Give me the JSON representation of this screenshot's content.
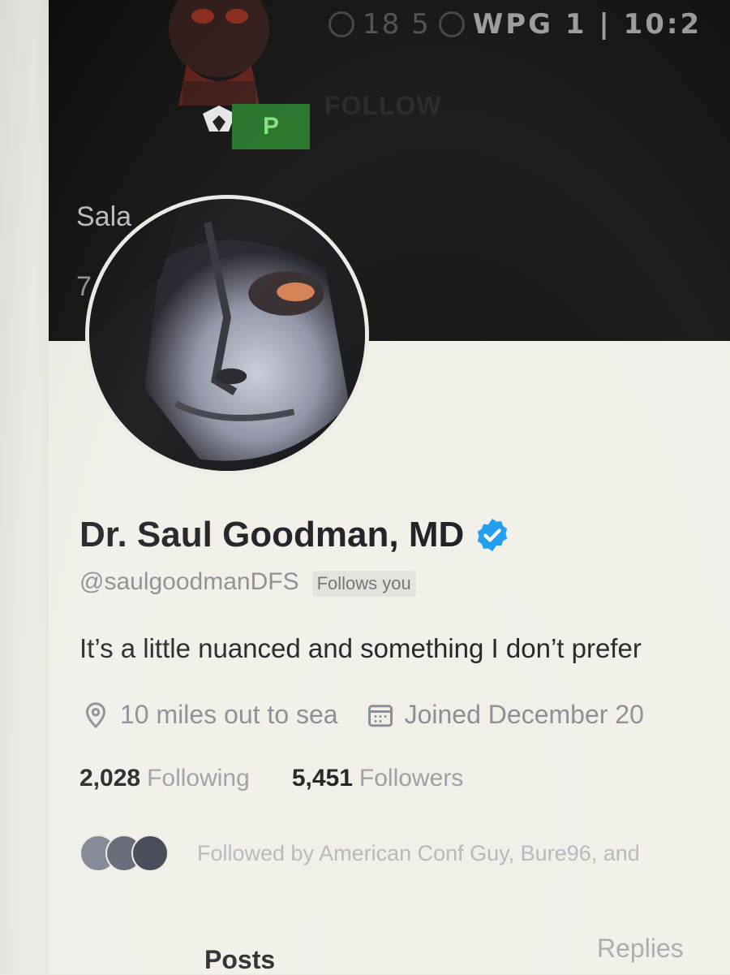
{
  "banner": {
    "stats_text": "18  5",
    "team_code": "WPG 1 | 10:2",
    "badge_letter": "P",
    "follow_label": "FOLLOW",
    "name_fragment": "Sala",
    "number_fragment": "7"
  },
  "profile": {
    "name": "Dr. Saul Goodman, MD",
    "handle": "@saulgoodmanDFS",
    "follows_you": "Follows you",
    "bio": "It’s a little nuanced and something I don’t prefer",
    "location": "10 miles out to sea",
    "joined": "Joined December 20",
    "following_count": "2,028",
    "following_label": "Following",
    "followers_count": "5,451",
    "followers_label": "Followers",
    "followed_by": "Followed by American Conf Guy, Bure96, and"
  },
  "tabs": {
    "posts": "Posts",
    "replies": "Replies"
  },
  "icons": {
    "verified": "verified-badge-icon",
    "location": "location-pin-icon",
    "calendar": "calendar-icon"
  },
  "colors": {
    "verified_blue": "#1d9bf0",
    "banner_bg": "#0b0b0c",
    "badge_green": "#1e6e1f"
  }
}
